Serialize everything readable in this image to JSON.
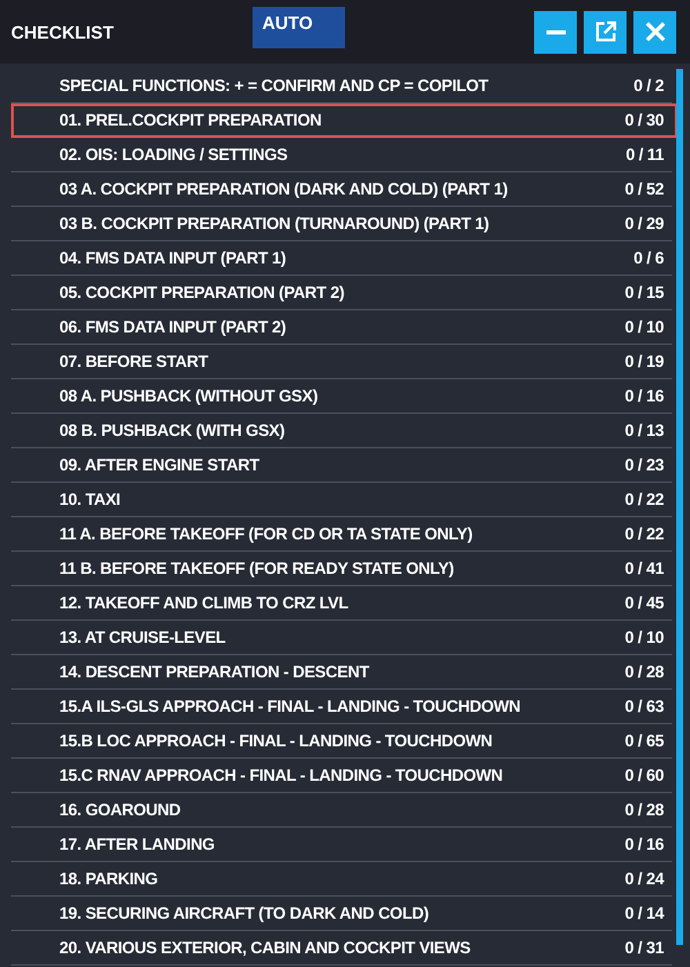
{
  "window": {
    "title": "CHECKLIST"
  },
  "mode_button": {
    "label": "AUTO"
  },
  "checklists": [
    {
      "label": "SPECIAL FUNCTIONS: + = CONFIRM AND CP = COPILOT",
      "count": "0 / 2",
      "selected": false
    },
    {
      "label": "01. PREL.COCKPIT PREPARATION",
      "count": "0 / 30",
      "selected": true
    },
    {
      "label": "02. OIS: LOADING / SETTINGS",
      "count": "0 / 11",
      "selected": false
    },
    {
      "label": "03 A. COCKPIT PREPARATION (DARK AND COLD) (PART 1)",
      "count": "0 / 52",
      "selected": false
    },
    {
      "label": "03 B. COCKPIT PREPARATION (TURNAROUND) (PART 1)",
      "count": "0 / 29",
      "selected": false
    },
    {
      "label": "04. FMS DATA INPUT (PART 1)",
      "count": "0 / 6",
      "selected": false
    },
    {
      "label": "05. COCKPIT PREPARATION (PART 2)",
      "count": "0 / 15",
      "selected": false
    },
    {
      "label": "06. FMS DATA INPUT (PART 2)",
      "count": "0 / 10",
      "selected": false
    },
    {
      "label": "07. BEFORE START",
      "count": "0 / 19",
      "selected": false
    },
    {
      "label": "08 A. PUSHBACK (WITHOUT GSX)",
      "count": "0 / 16",
      "selected": false
    },
    {
      "label": "08 B. PUSHBACK (WITH GSX)",
      "count": "0 / 13",
      "selected": false
    },
    {
      "label": "09. AFTER ENGINE START",
      "count": "0 / 23",
      "selected": false
    },
    {
      "label": "10. TAXI",
      "count": "0 / 22",
      "selected": false
    },
    {
      "label": "11 A. BEFORE TAKEOFF (FOR CD OR TA STATE ONLY)",
      "count": "0 / 22",
      "selected": false
    },
    {
      "label": "11 B. BEFORE TAKEOFF (FOR READY STATE ONLY)",
      "count": "0 / 41",
      "selected": false
    },
    {
      "label": "12. TAKEOFF AND CLIMB TO CRZ LVL",
      "count": "0 / 45",
      "selected": false
    },
    {
      "label": "13. AT CRUISE-LEVEL",
      "count": "0 / 10",
      "selected": false
    },
    {
      "label": "14. DESCENT PREPARATION - DESCENT",
      "count": "0 / 28",
      "selected": false
    },
    {
      "label": "15.A ILS-GLS APPROACH - FINAL - LANDING - TOUCHDOWN",
      "count": "0 / 63",
      "selected": false
    },
    {
      "label": "15.B LOC APPROACH - FINAL - LANDING - TOUCHDOWN",
      "count": "0 / 65",
      "selected": false
    },
    {
      "label": "15.C RNAV APPROACH - FINAL - LANDING - TOUCHDOWN",
      "count": "0 / 60",
      "selected": false
    },
    {
      "label": "16. GOAROUND",
      "count": "0 / 28",
      "selected": false
    },
    {
      "label": "17. AFTER LANDING",
      "count": "0 / 16",
      "selected": false
    },
    {
      "label": "18. PARKING",
      "count": "0 / 24",
      "selected": false
    },
    {
      "label": "19. SECURING AIRCRAFT (TO DARK AND COLD)",
      "count": "0 / 14",
      "selected": false
    },
    {
      "label": "20. VARIOUS EXTERIOR, CABIN AND COCKPIT VIEWS",
      "count": "0 / 31",
      "selected": false
    }
  ]
}
